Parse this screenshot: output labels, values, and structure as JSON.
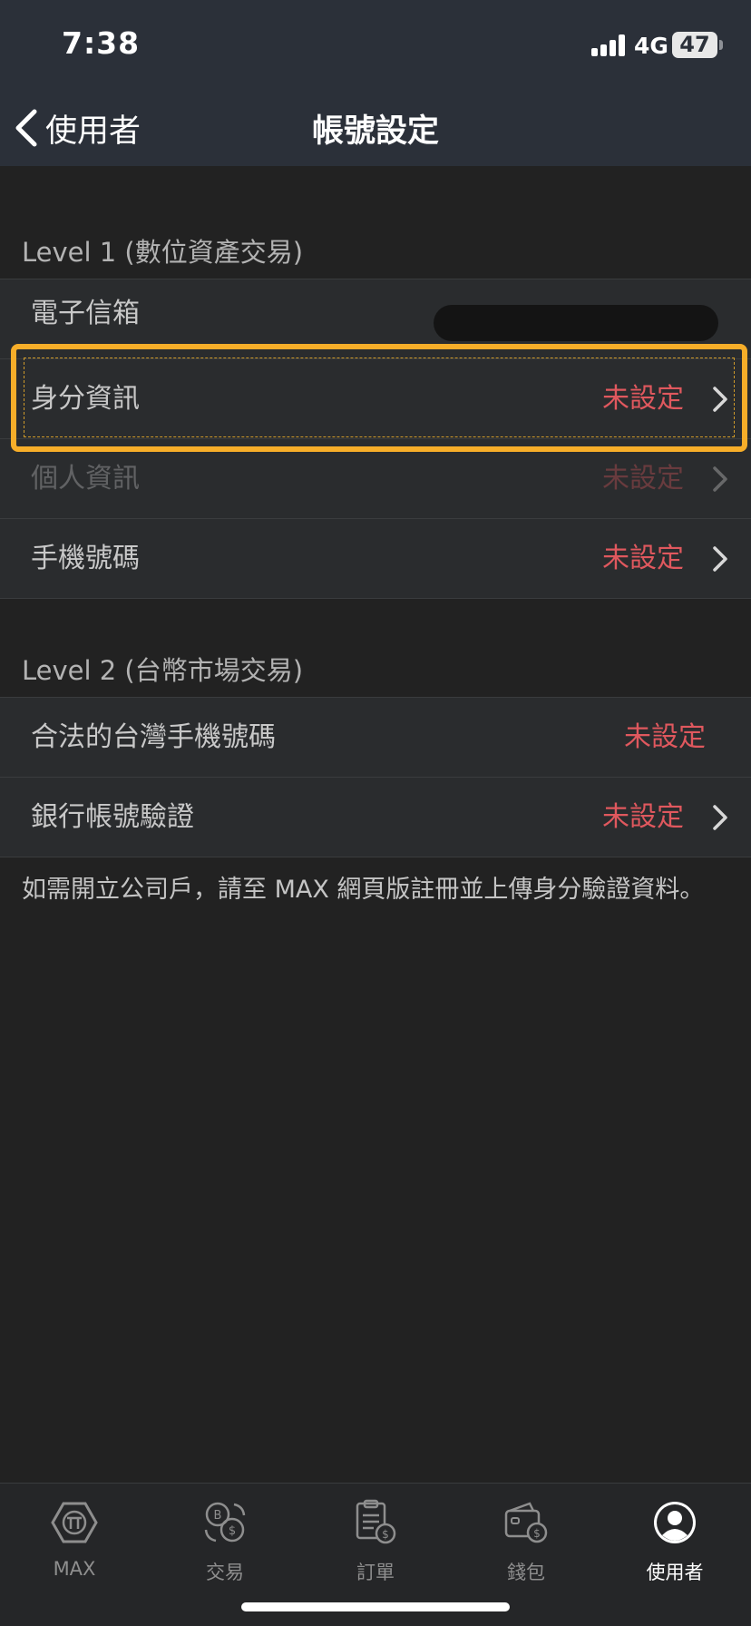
{
  "status_bar": {
    "time": "7:38",
    "network": "4G",
    "battery": "47"
  },
  "nav": {
    "back_label": "使用者",
    "title": "帳號設定"
  },
  "level1": {
    "header": "Level 1 (數位資產交易)",
    "rows": [
      {
        "label": "電子信箱",
        "value": ""
      },
      {
        "label": "身分資訊",
        "value": "未設定"
      },
      {
        "label": "個人資訊",
        "value": "未設定"
      },
      {
        "label": "手機號碼",
        "value": "未設定"
      }
    ]
  },
  "level2": {
    "header": "Level 2 (台幣市場交易)",
    "rows": [
      {
        "label": "合法的台灣手機號碼",
        "value": "未設定"
      },
      {
        "label": "銀行帳號驗證",
        "value": "未設定"
      }
    ]
  },
  "note": "如需開立公司戶，請至 MAX 網頁版註冊並上傳身分驗證資料。",
  "tabs": [
    {
      "label": "MAX",
      "icon": "max-logo-icon"
    },
    {
      "label": "交易",
      "icon": "exchange-icon"
    },
    {
      "label": "訂單",
      "icon": "order-icon"
    },
    {
      "label": "錢包",
      "icon": "wallet-icon"
    },
    {
      "label": "使用者",
      "icon": "user-icon"
    }
  ],
  "colors": {
    "accent_unset": "#e0585e",
    "highlight": "#f7ae29",
    "topbar": "#2b3039",
    "background": "#222222"
  }
}
